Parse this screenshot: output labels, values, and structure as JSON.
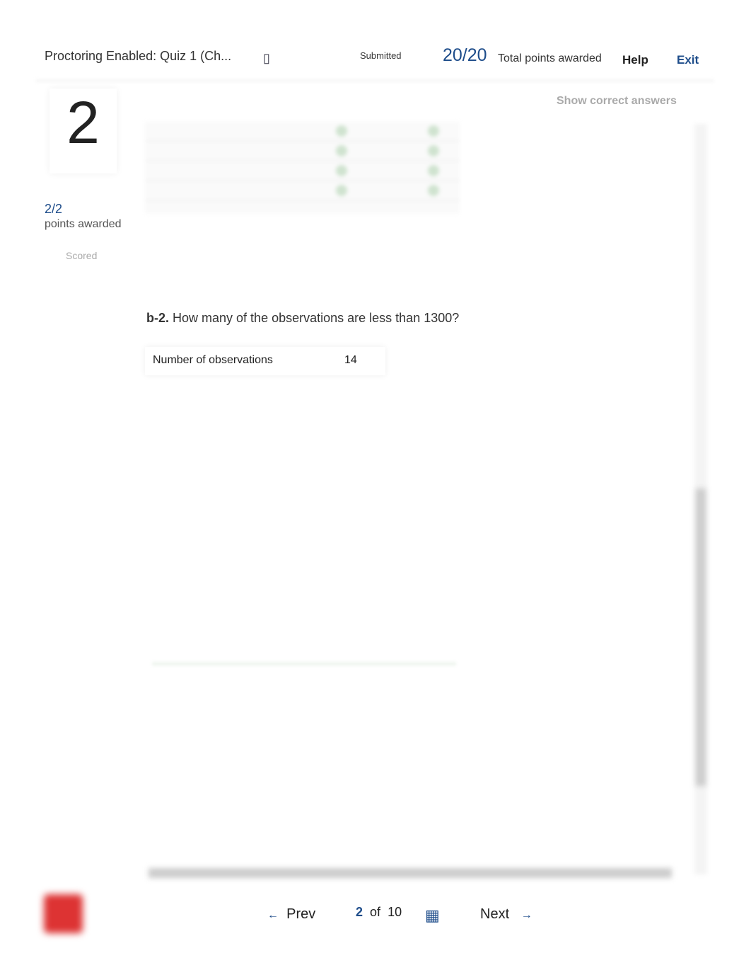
{
  "header": {
    "title": "Proctoring Enabled: Quiz 1 (Ch...",
    "status": "Submitted",
    "score": "20/20",
    "score_label": "Total points awarded",
    "help": "Help",
    "exit": "Exit"
  },
  "question": {
    "number": "2",
    "points": "2/2",
    "points_label": "points awarded",
    "scored": "Scored",
    "show_correct": "Show correct answers",
    "prefix": "b-2.",
    "text": " How many of the observations are less than 1300?",
    "answer_label": "Number of observations",
    "answer_value": "14"
  },
  "footer": {
    "prev": "Prev",
    "current": "2",
    "of": "of",
    "total": "10",
    "next": "Next",
    "prev_arrow": "←",
    "next_arrow": "→",
    "grid_icon": "▦"
  },
  "colors": {
    "accent": "#1d4c8a",
    "logo": "#dd3333"
  }
}
